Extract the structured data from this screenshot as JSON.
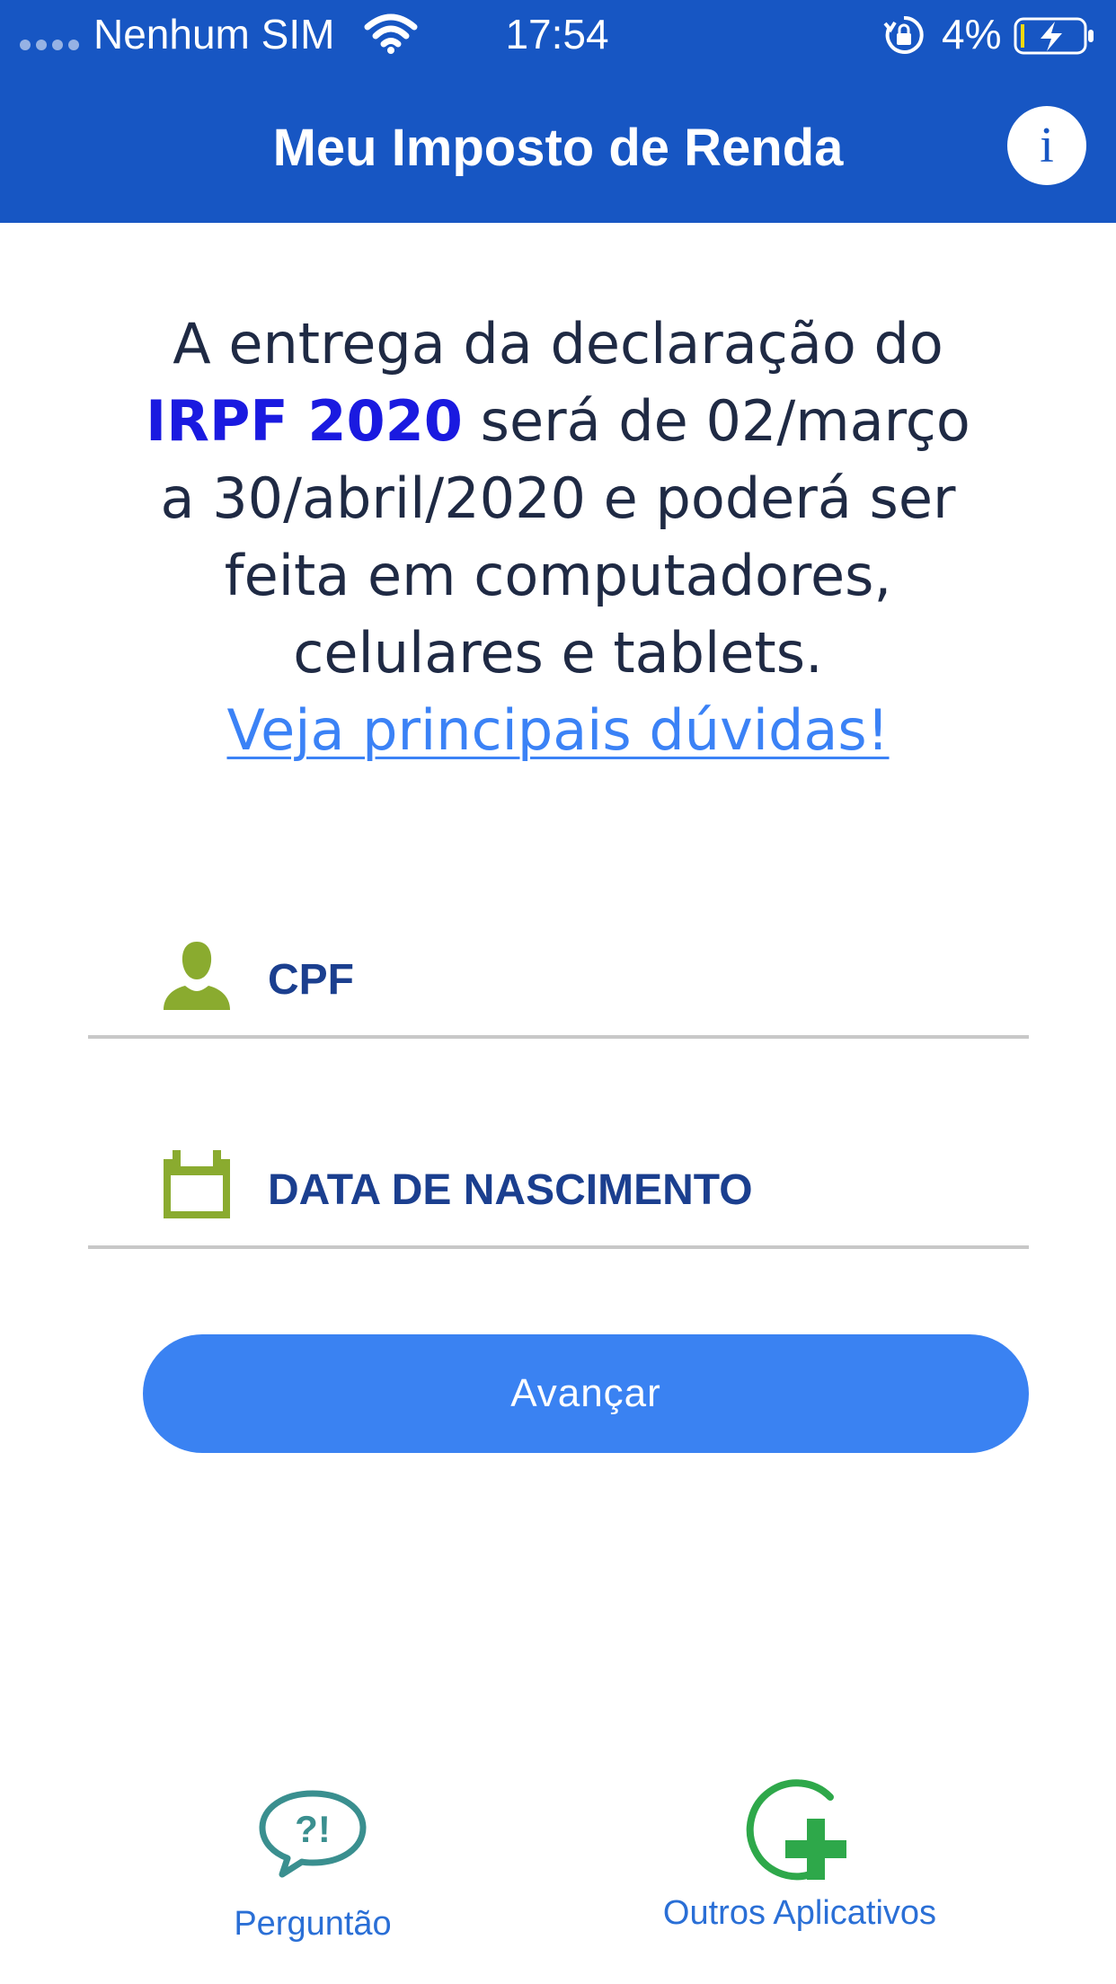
{
  "status_bar": {
    "carrier": "Nenhum SIM",
    "time": "17:54",
    "battery_percent": "4%",
    "battery_level": 0.04,
    "charging": true,
    "icons": [
      "signal-icon",
      "wifi-icon",
      "orientation-lock-icon",
      "battery-charging-icon"
    ]
  },
  "header": {
    "title": "Meu Imposto de Renda",
    "info_label": "i",
    "background_color": "#1756c3"
  },
  "notice": {
    "line1": "A entrega da declaração do",
    "highlight": "IRPF 2020",
    "line2_rest": "será de 02/março",
    "line3": "a 30/abril/2020 e poderá ser",
    "line4": "feita em computadores,",
    "line5": "celulares e tablets.",
    "link_text": "Veja principais dúvidas!",
    "highlight_color": "#1a1ae0",
    "link_color": "#3b82f6"
  },
  "form": {
    "cpf": {
      "placeholder": "CPF",
      "value": "",
      "icon": "person-icon"
    },
    "birth_date": {
      "placeholder": "DATA DE NASCIMENTO",
      "value": "",
      "icon": "calendar-icon"
    },
    "icon_color": "#8aab2f"
  },
  "actions": {
    "advance_label": "Avançar",
    "advance_color": "#3a82f2"
  },
  "bottom_nav": [
    {
      "label": "Perguntão",
      "icon": "question-bubble-icon",
      "icon_text": "?!"
    },
    {
      "label": "Outros Aplicativos",
      "icon": "add-circle-icon"
    }
  ]
}
